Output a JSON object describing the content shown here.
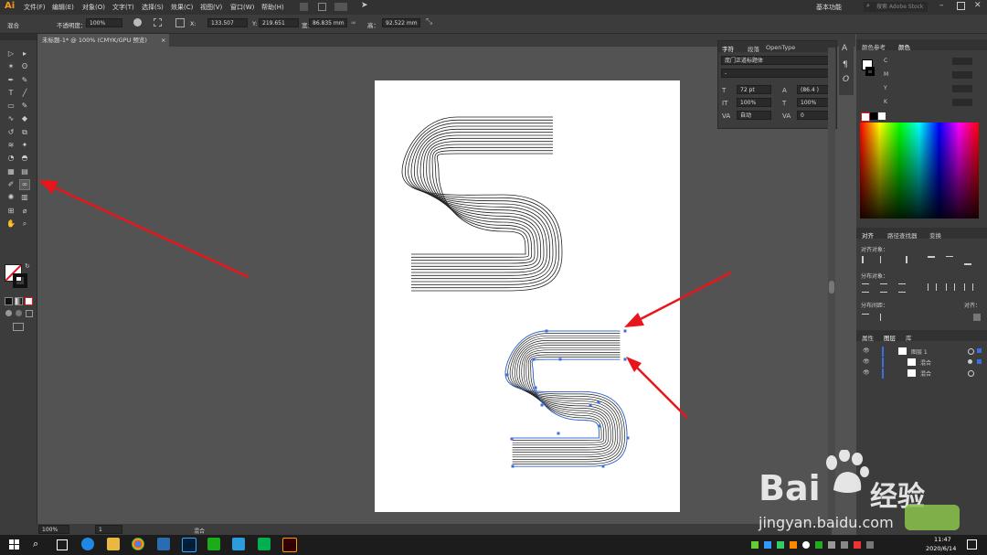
{
  "menubar": {
    "logo": "Ai",
    "items": [
      "文件(F)",
      "编辑(E)",
      "对象(O)",
      "文字(T)",
      "选择(S)",
      "效果(C)",
      "视图(V)",
      "窗口(W)",
      "帮助(H)"
    ],
    "workspace": "基本功能",
    "search_placeholder": "搜索 Adobe Stock"
  },
  "controlbar": {
    "selection_type": "混合",
    "opacity_label": "不透明度：",
    "opacity_value": "100%",
    "x_label": "X:",
    "x_value": "133.507",
    "y_label": "Y:",
    "y_value": "219.651",
    "w_label": "宽：",
    "w_value": "86.835 mm",
    "h_label": "高：",
    "h_value": "92.522 mm"
  },
  "document": {
    "tab_title": "未标题-1* @ 100% (CMYK/GPU 预览)",
    "tab_close": "×"
  },
  "character_panel": {
    "tabs": [
      "字符",
      "段落",
      "OpenType"
    ],
    "font_name": "庞门正道标题体",
    "font_style": "-",
    "font_size": "72 pt",
    "leading": "(86.4 )",
    "scale_v": "100%",
    "scale_h": "100%",
    "kerning": "自动",
    "tracking": "0"
  },
  "right_panels": {
    "color_tabs": [
      "颜色参考",
      "颜色"
    ],
    "color_channels": [
      "C",
      "M",
      "Y",
      "K"
    ],
    "align_tabs": [
      "对齐",
      "路径查找器",
      "变换"
    ],
    "align_objects_label": "对齐对象：",
    "distribute_objects_label": "分布对象：",
    "distribute_spacing_label": "分布间距：",
    "align_to_label": "对齐：",
    "layers_tabs": [
      "属性",
      "图层",
      "库"
    ],
    "layers": [
      "图层 1",
      "混合",
      "混合"
    ]
  },
  "statusbar": {
    "zoom": "100%",
    "artboard": "1",
    "selection": "混合"
  },
  "taskbar": {
    "time": "11:47",
    "date": "2020/6/14"
  },
  "watermark": {
    "brand": "Bai",
    "brand_cn": "经验",
    "url": "jingyan.baidu.com"
  },
  "colors": {
    "arrow": "#e8161b",
    "path_selection": "#3a6fdc",
    "ai_orange": "#f29b1d"
  }
}
